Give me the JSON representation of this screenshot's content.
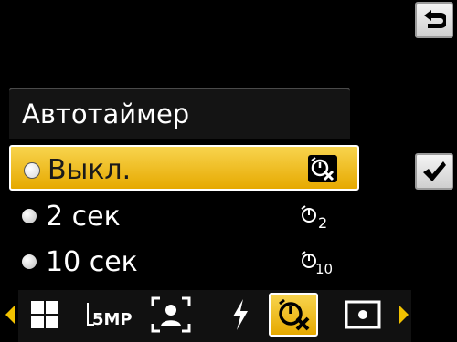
{
  "panel": {
    "title": "Автотаймер"
  },
  "options": [
    {
      "label": "Выкл.",
      "icon": "selftimer-off-icon",
      "selected": true
    },
    {
      "label": "2 сек",
      "icon": "selftimer-2s-icon",
      "icon_sub": "2",
      "selected": false
    },
    {
      "label": "10 сек",
      "icon": "selftimer-10s-icon",
      "icon_sub": "10",
      "selected": false
    }
  ],
  "toolbar": {
    "size_label": "5MP",
    "items": [
      "scene-mode-icon",
      "image-size-icon",
      "face-detection-icon",
      "flash-icon",
      "selftimer-icon",
      "metering-icon"
    ],
    "selected": "selftimer-icon"
  },
  "colors": {
    "accent": "#f2c200",
    "background": "#000000"
  }
}
